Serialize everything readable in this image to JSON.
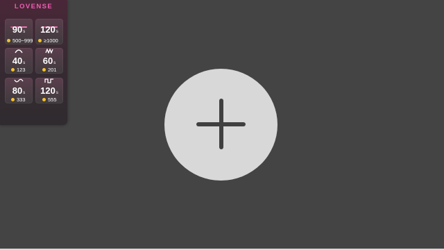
{
  "brand": "LOVENSE",
  "levels": [
    {
      "icon": "low-vibe-bar",
      "duration": "90",
      "unit": "s",
      "tokens": "500~999"
    },
    {
      "icon": "high-vibe-bar",
      "duration": "120",
      "unit": "s",
      "tokens": "≥1000"
    },
    {
      "icon": "wave-icon",
      "duration": "40",
      "unit": "s",
      "tokens": "123"
    },
    {
      "icon": "pulse-icon",
      "duration": "60",
      "unit": "s",
      "tokens": "201"
    },
    {
      "icon": "earthquake-icon",
      "duration": "80",
      "unit": "s",
      "tokens": "333"
    },
    {
      "icon": "fireworks-icon",
      "duration": "120",
      "unit": "s",
      "tokens": "555"
    }
  ],
  "colors": {
    "brand": "#f25cb4",
    "coin": "#f2c12e",
    "background": "#444444",
    "add_button": "#d8d8d8"
  },
  "add_button_icon": "plus-icon"
}
